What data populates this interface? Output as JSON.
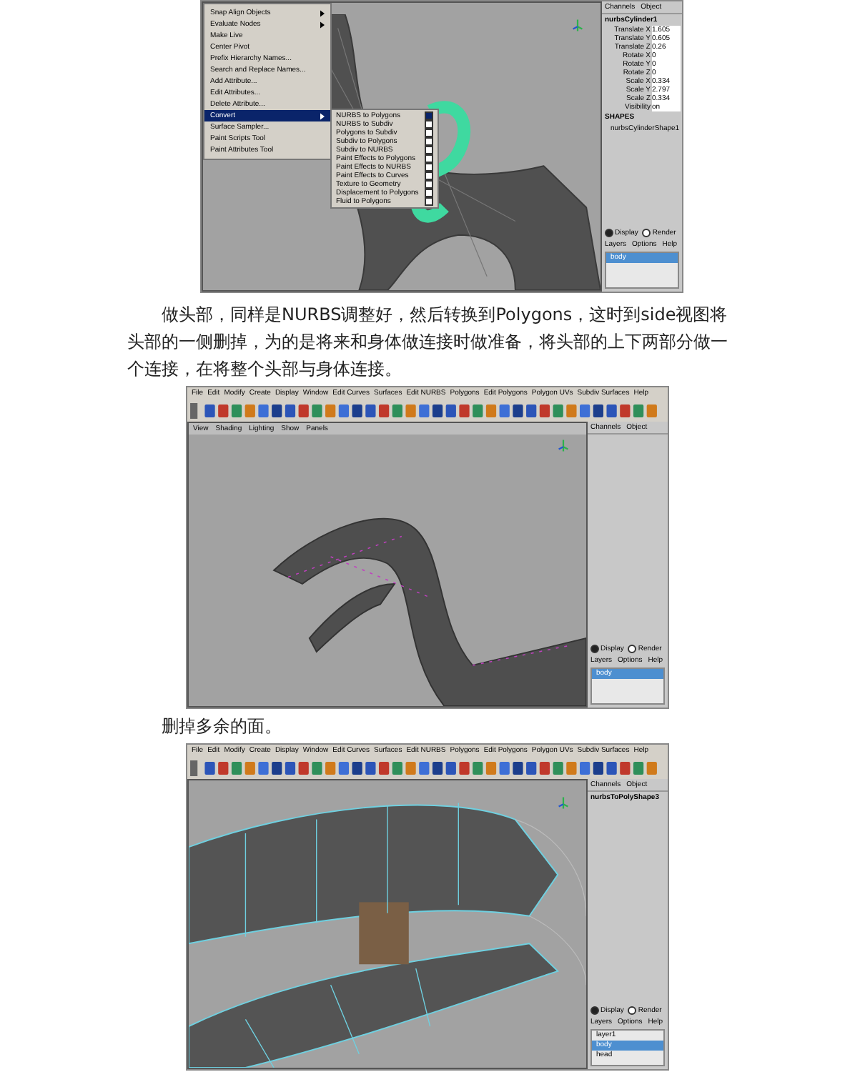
{
  "screenshots": [
    {
      "kind": "body",
      "menu": {
        "items": [
          {
            "label": "Snap Align Objects",
            "submenu": true,
            "selected": false
          },
          {
            "label": "Evaluate Nodes",
            "submenu": true,
            "selected": false
          },
          {
            "label": "Make Live",
            "submenu": false,
            "selected": false
          },
          {
            "label": "Center Pivot",
            "submenu": false,
            "selected": false
          },
          {
            "label": "Prefix Hierarchy Names...",
            "submenu": false,
            "selected": false
          },
          {
            "label": "Search and Replace Names...",
            "submenu": false,
            "selected": false
          },
          {
            "label": "Add Attribute...",
            "submenu": false,
            "selected": false
          },
          {
            "label": "Edit Attributes...",
            "submenu": false,
            "selected": false
          },
          {
            "label": "Delete Attribute...",
            "submenu": false,
            "selected": false
          },
          {
            "label": "Convert",
            "submenu": true,
            "selected": true
          },
          {
            "label": "Surface Sampler...",
            "submenu": false,
            "selected": false
          },
          {
            "label": "Paint Scripts Tool",
            "submenu": false,
            "selected": false
          },
          {
            "label": "Paint Attributes Tool",
            "submenu": false,
            "selected": false
          }
        ],
        "submenu": [
          {
            "label": "NURBS to Polygons",
            "selected": true
          },
          {
            "label": "NURBS to Subdiv",
            "selected": false
          },
          {
            "label": "Polygons to Subdiv",
            "selected": false
          },
          {
            "label": "Subdiv to Polygons",
            "selected": false
          },
          {
            "label": "Subdiv to NURBS",
            "selected": false
          },
          {
            "label": "Paint Effects to Polygons",
            "selected": false
          },
          {
            "label": "Paint Effects to NURBS",
            "selected": false
          },
          {
            "label": "Paint Effects to Curves",
            "selected": false
          },
          {
            "label": "Texture to Geometry",
            "selected": false
          },
          {
            "label": "Displacement to Polygons",
            "selected": false
          },
          {
            "label": "Fluid to Polygons",
            "selected": false
          }
        ]
      },
      "channel_box": {
        "tabs": [
          "Channels",
          "Object"
        ],
        "object": "nurbsCylinder1",
        "attributes": [
          {
            "name": "Translate X",
            "value": "1.605"
          },
          {
            "name": "Translate Y",
            "value": "0.605"
          },
          {
            "name": "Translate Z",
            "value": "0.26"
          },
          {
            "name": "Rotate X",
            "value": "0"
          },
          {
            "name": "Rotate Y",
            "value": "0"
          },
          {
            "name": "Rotate Z",
            "value": "0"
          },
          {
            "name": "Scale X",
            "value": "0.334"
          },
          {
            "name": "Scale Y",
            "value": "2.797"
          },
          {
            "name": "Scale Z",
            "value": "0.334"
          },
          {
            "name": "Visibility",
            "value": "on"
          }
        ],
        "shapes_heading": "SHAPES",
        "shape": "nurbsCylinderShape1"
      },
      "layer_modes": [
        {
          "label": "Display",
          "selected": true
        },
        {
          "label": "Render",
          "selected": false
        }
      ],
      "layer_menu": [
        "Layers",
        "Options",
        "Help"
      ],
      "layers": [
        {
          "name": "body",
          "selected": true
        }
      ]
    },
    {
      "kind": "head",
      "menu_bar": [
        "File",
        "Edit",
        "Modify",
        "Create",
        "Display",
        "Window",
        "Edit Curves",
        "Surfaces",
        "Edit NURBS",
        "Polygons",
        "Edit Polygons",
        "Polygon UVs",
        "Subdiv Surfaces",
        "Help"
      ],
      "panel_menu": [
        "View",
        "Shading",
        "Lighting",
        "Show",
        "Panels"
      ],
      "channel_box": {
        "tabs": [
          "Channels",
          "Object"
        ]
      },
      "layer_modes": [
        {
          "label": "Display",
          "selected": true
        },
        {
          "label": "Render",
          "selected": false
        }
      ],
      "layer_menu": [
        "Layers",
        "Options",
        "Help"
      ],
      "layers": [
        {
          "name": "body",
          "selected": true
        }
      ]
    },
    {
      "kind": "jaw",
      "menu_bar": [
        "File",
        "Edit",
        "Modify",
        "Create",
        "Display",
        "Window",
        "Edit Curves",
        "Surfaces",
        "Edit NURBS",
        "Polygons",
        "Edit Polygons",
        "Polygon UVs",
        "Subdiv Surfaces",
        "Help"
      ],
      "channel_box": {
        "tabs": [
          "Channels",
          "Object"
        ],
        "object": "nurbsToPolyShape3"
      },
      "layer_modes": [
        {
          "label": "Display",
          "selected": true
        },
        {
          "label": "Render",
          "selected": false
        }
      ],
      "layer_menu": [
        "Layers",
        "Options",
        "Help"
      ],
      "layers": [
        {
          "name": "layer1",
          "selected": false
        },
        {
          "name": "body",
          "selected": true
        },
        {
          "name": "head",
          "selected": false
        }
      ]
    }
  ],
  "paragraphs": [
    "做头部，同样是NURBS调整好，然后转换到Polygons，这时到side视图将头部的一侧删掉，为的是将来和身体做连接时做准备，将头部的上下两部分做一个连接，在将整个头部与身体连接。",
    "删掉多余的面。"
  ]
}
